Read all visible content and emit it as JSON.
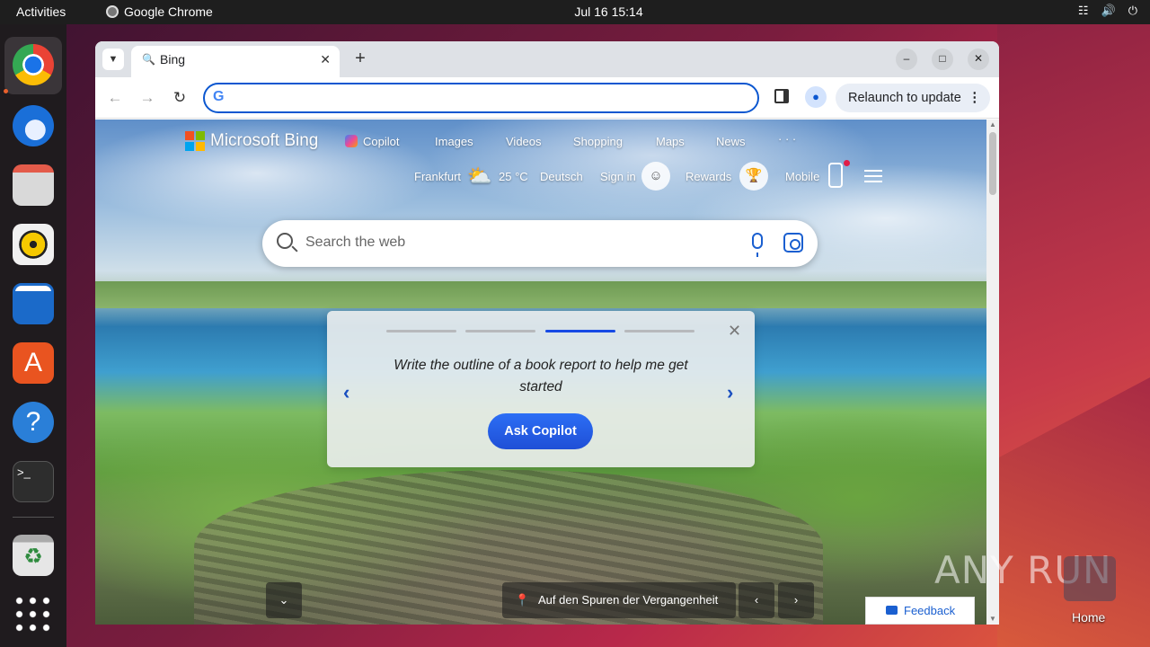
{
  "topbar": {
    "activities": "Activities",
    "app_name": "Google Chrome",
    "clock": "Jul 16  15:14"
  },
  "dock": {
    "items": [
      "Google Chrome",
      "Thunderbird Mail",
      "Files",
      "Rhythmbox",
      "LibreOffice Writer",
      "Ubuntu Software",
      "Help",
      "Terminal",
      "Trash",
      "Show Applications"
    ]
  },
  "browser": {
    "tab_title": "Bing",
    "omnibox_value": "",
    "relaunch_label": "Relaunch to update"
  },
  "bing": {
    "logo_text": "Microsoft Bing",
    "nav": {
      "copilot": "Copilot",
      "images": "Images",
      "videos": "Videos",
      "shopping": "Shopping",
      "maps": "Maps",
      "news": "News",
      "more": "· · ·"
    },
    "weather_city": "Frankfurt",
    "temperature": "25 °C",
    "language": "Deutsch",
    "sign_in": "Sign in",
    "rewards": "Rewards",
    "mobile": "Mobile",
    "search_placeholder": "Search the web",
    "card": {
      "prompt": "Write the outline of a book report to help me get started",
      "button": "Ask Copilot",
      "step": 3,
      "steps": 4
    },
    "image_caption": "Auf den Spuren der Vergangenheit",
    "feedback": "Feedback"
  },
  "desktop": {
    "home_label": "Home",
    "watermark": "ANY RUN"
  },
  "colors": {
    "accent": "#174ae4",
    "omnibox_border": "#0b57d0",
    "topbar": "#1e1e1e"
  }
}
